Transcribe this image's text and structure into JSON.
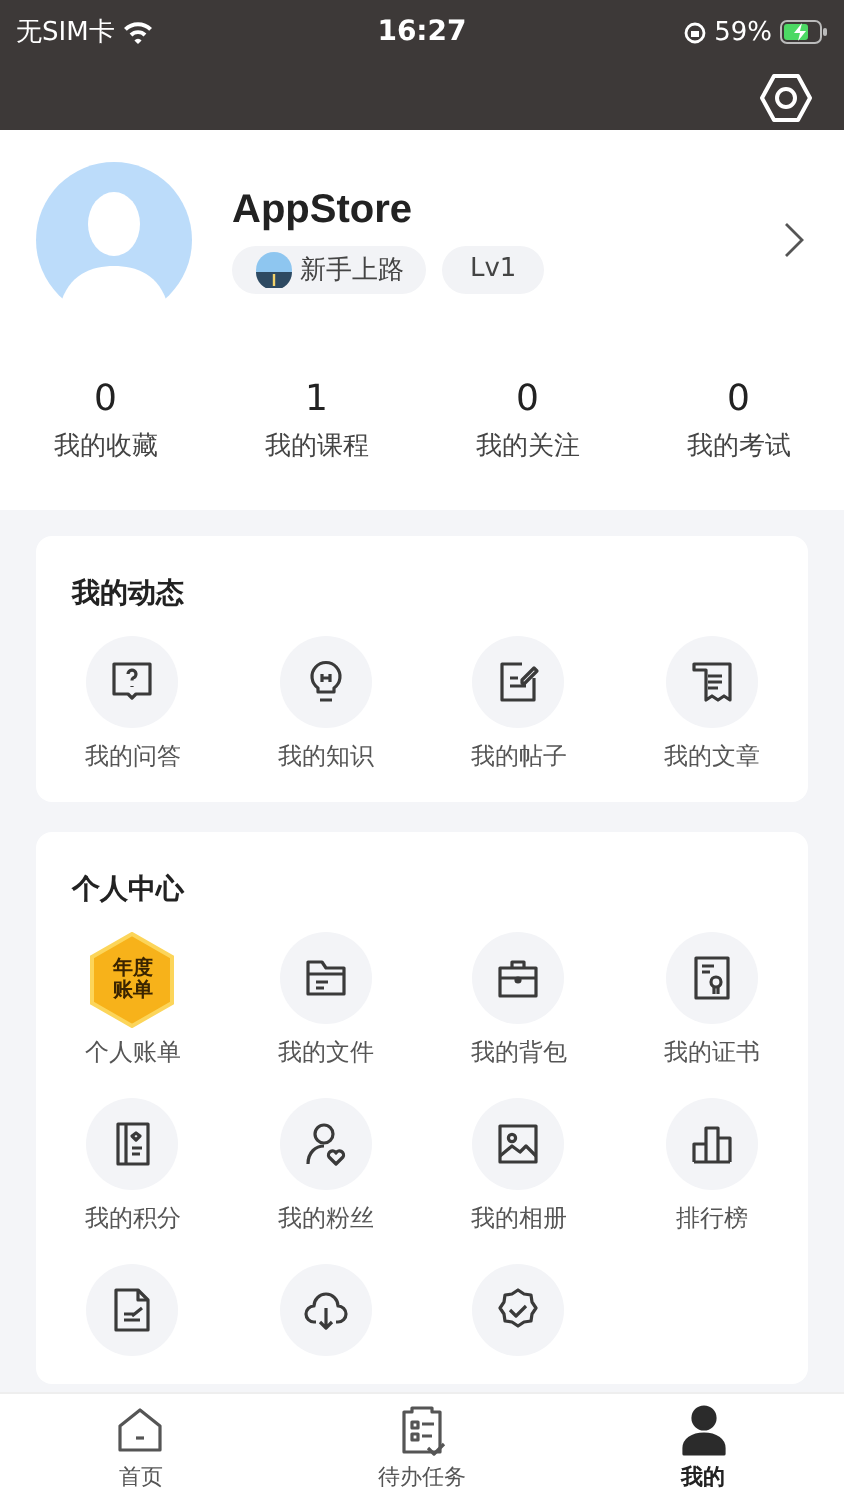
{
  "status_bar": {
    "carrier": "无SIM卡",
    "time": "16:27",
    "battery": "59%"
  },
  "profile": {
    "name": "AppStore",
    "badge": "新手上路",
    "level": "Lv1"
  },
  "stats": [
    {
      "value": "0",
      "label": "我的收藏"
    },
    {
      "value": "1",
      "label": "我的课程"
    },
    {
      "value": "0",
      "label": "我的关注"
    },
    {
      "value": "0",
      "label": "我的考试"
    }
  ],
  "sections": [
    {
      "title": "我的动态",
      "items": [
        {
          "kind": "question",
          "label": "我的问答"
        },
        {
          "kind": "bulb",
          "label": "我的知识"
        },
        {
          "kind": "edit",
          "label": "我的帖子"
        },
        {
          "kind": "article",
          "label": "我的文章"
        }
      ]
    },
    {
      "title": "个人中心",
      "items": [
        {
          "kind": "bill",
          "badge_lines": [
            "年度",
            "账单"
          ],
          "label": "个人账单"
        },
        {
          "kind": "folder",
          "label": "我的文件"
        },
        {
          "kind": "bag",
          "label": "我的背包"
        },
        {
          "kind": "certificate",
          "label": "我的证书"
        },
        {
          "kind": "points",
          "label": "我的积分"
        },
        {
          "kind": "fans",
          "label": "我的粉丝"
        },
        {
          "kind": "photo",
          "label": "我的相册"
        },
        {
          "kind": "ranking",
          "label": "排行榜"
        },
        {
          "kind": "draft"
        },
        {
          "kind": "download"
        },
        {
          "kind": "check"
        }
      ]
    }
  ],
  "tab_bar": [
    {
      "kind": "home",
      "label": "首页",
      "selected": false
    },
    {
      "kind": "tasks",
      "label": "待办任务",
      "selected": false
    },
    {
      "kind": "me",
      "label": "我的",
      "selected": true
    }
  ]
}
